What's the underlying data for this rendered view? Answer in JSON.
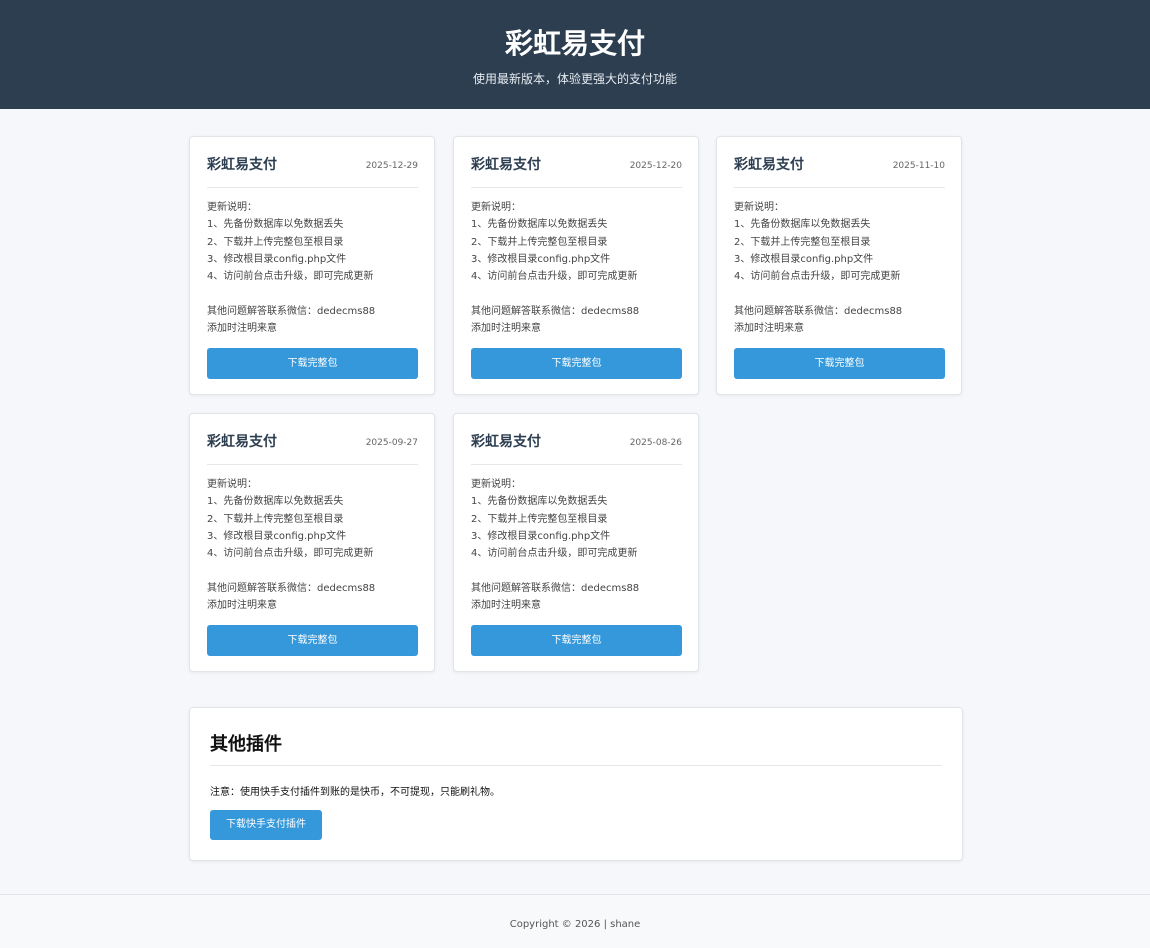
{
  "header": {
    "title": "彩虹易支付",
    "subtitle": "使用最新版本，体验更强大的支付功能"
  },
  "releases": [
    {
      "title": "彩虹易支付",
      "date": "2025-12-29",
      "notes": [
        "更新说明：",
        "1、先备份数据库以免数据丢失",
        "2、下载并上传完整包至根目录",
        "3、修改根目录config.php文件",
        "4、访问前台点击升级，即可完成更新",
        "",
        "其他问题解答联系微信：dedecms88",
        "添加时注明来意"
      ],
      "button": "下载完整包"
    },
    {
      "title": "彩虹易支付",
      "date": "2025-12-20",
      "notes": [
        "更新说明：",
        "1、先备份数据库以免数据丢失",
        "2、下载并上传完整包至根目录",
        "3、修改根目录config.php文件",
        "4、访问前台点击升级，即可完成更新",
        "",
        "其他问题解答联系微信：dedecms88",
        "添加时注明来意"
      ],
      "button": "下载完整包"
    },
    {
      "title": "彩虹易支付",
      "date": "2025-11-10",
      "notes": [
        "更新说明：",
        "1、先备份数据库以免数据丢失",
        "2、下载并上传完整包至根目录",
        "3、修改根目录config.php文件",
        "4、访问前台点击升级，即可完成更新",
        "",
        "其他问题解答联系微信：dedecms88",
        "添加时注明来意"
      ],
      "button": "下载完整包"
    },
    {
      "title": "彩虹易支付",
      "date": "2025-09-27",
      "notes": [
        "更新说明：",
        "1、先备份数据库以免数据丢失",
        "2、下载并上传完整包至根目录",
        "3、修改根目录config.php文件",
        "4、访问前台点击升级，即可完成更新",
        "",
        "其他问题解答联系微信：dedecms88",
        "添加时注明来意"
      ],
      "button": "下载完整包"
    },
    {
      "title": "彩虹易支付",
      "date": "2025-08-26",
      "notes": [
        "更新说明：",
        "1、先备份数据库以免数据丢失",
        "2、下载并上传完整包至根目录",
        "3、修改根目录config.php文件",
        "4、访问前台点击升级，即可完成更新",
        "",
        "其他问题解答联系微信：dedecms88",
        "添加时注明来意"
      ],
      "button": "下载完整包"
    }
  ],
  "plugins": {
    "title": "其他插件",
    "note": "注意：使用快手支付插件到账的是快币，不可提现，只能刷礼物。",
    "button": "下载快手支付插件"
  },
  "footer": {
    "copyright": "Copyright © 2026 | shane"
  },
  "colors": {
    "header_bg": "#2c3e50",
    "accent": "#3498db",
    "page_bg": "#f5f7fa"
  }
}
